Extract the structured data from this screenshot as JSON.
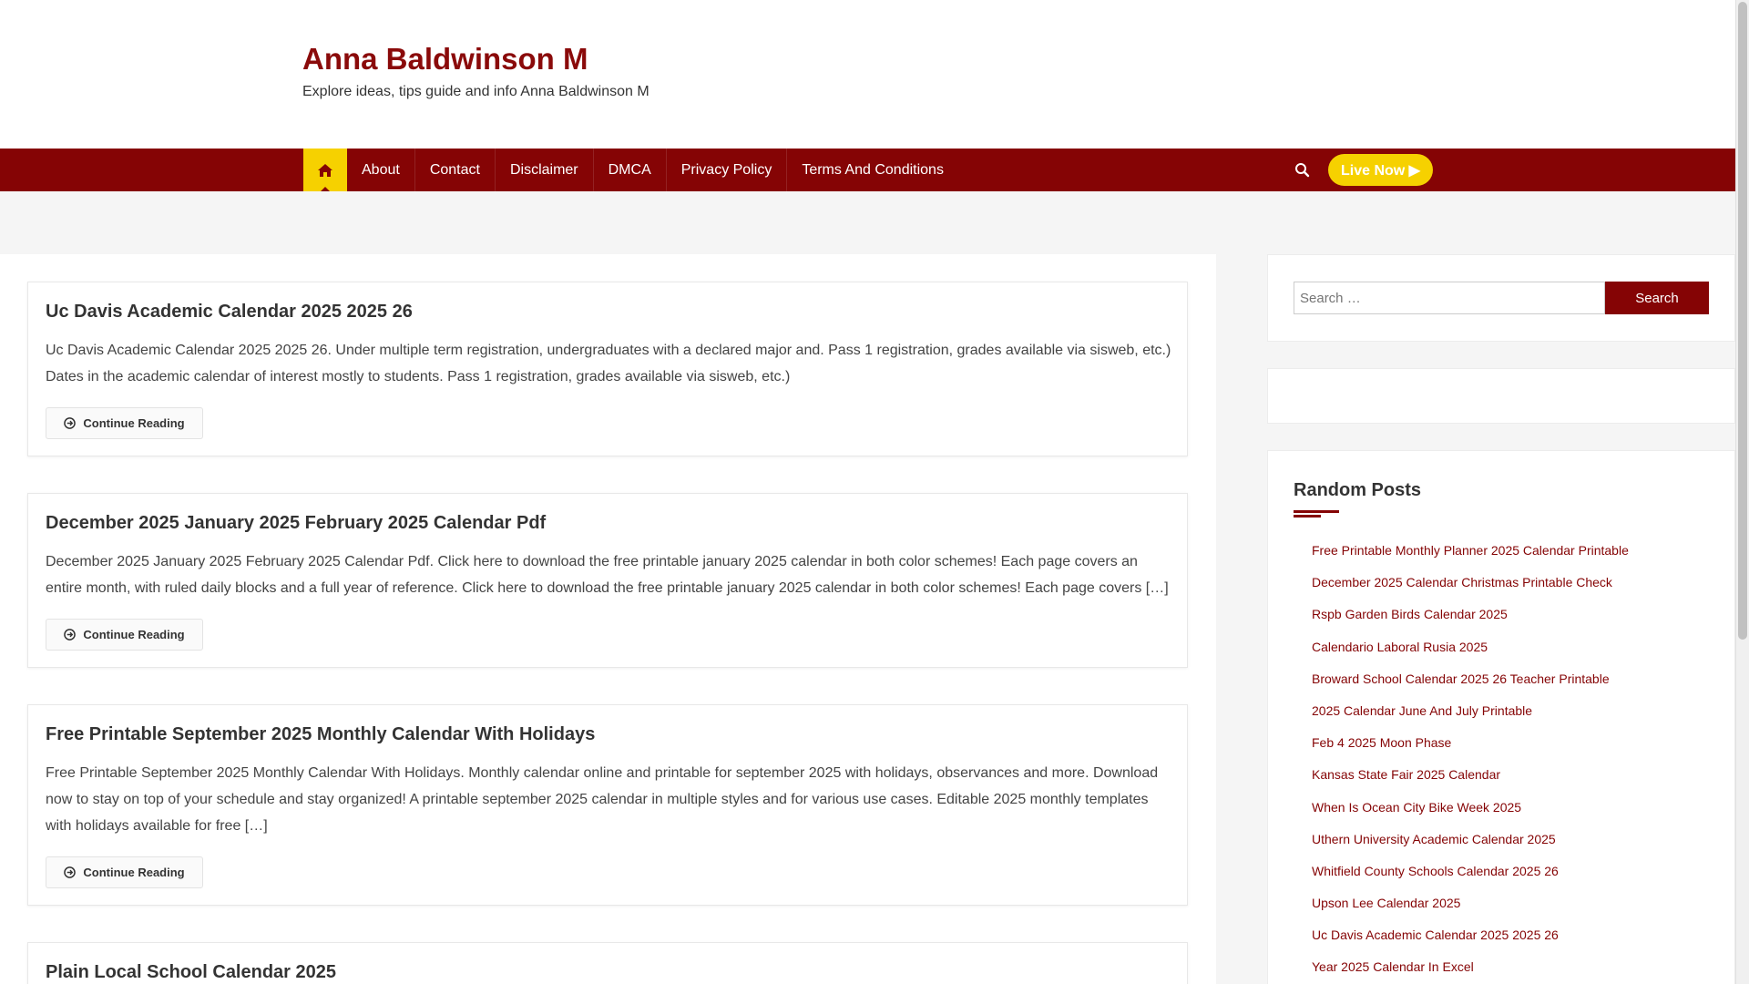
{
  "site": {
    "title": "Anna Baldwinson M",
    "description": "Explore ideas, tips guide and info Anna Baldwinson M"
  },
  "nav": {
    "items": [
      "About",
      "Contact",
      "Disclaimer",
      "DMCA",
      "Privacy Policy",
      "Terms And Conditions"
    ],
    "live_label": "Live Now ▶"
  },
  "posts": [
    {
      "title": "Uc Davis Academic Calendar 2025 2025 26",
      "excerpt": "Uc Davis Academic Calendar 2025 2025 26. Under multiple term registration, undergraduates with a declared major and. Pass 1 registration, grades available via sisweb, etc.) Dates in the academic calendar of interest mostly to students. Pass 1 registration, grades available via sisweb, etc.)",
      "button": "Continue Reading"
    },
    {
      "title": "December 2025 January 2025 February 2025 Calendar Pdf",
      "excerpt": "December 2025 January 2025 February 2025 Calendar Pdf. Click here to download the free printable january 2025 calendar in both color schemes! Each page covers an entire month, with ruled daily blocks and a full year of reference. Click here to download the free printable january 2025 calendar in both color schemes! Each page covers […]",
      "button": "Continue Reading"
    },
    {
      "title": "Free Printable September 2025 Monthly Calendar With Holidays",
      "excerpt": "Free Printable September 2025 Monthly Calendar With Holidays. Monthly calendar online and printable for september 2025 with holidays, observances and more. Download now to stay on top of your schedule and stay organized! A printable september 2025 calendar in multiple styles and for various use cases. Editable 2025 monthly templates with holidays available for free […]",
      "button": "Continue Reading"
    },
    {
      "title": "Plain Local School Calendar 2025"
    }
  ],
  "sidebar": {
    "search": {
      "placeholder": "Search …",
      "button": "Search"
    },
    "random_posts": {
      "title": "Random Posts",
      "items": [
        "Free Printable Monthly Planner 2025 Calendar Printable",
        "December 2025 Calendar Christmas Printable Check",
        "Rspb Garden Birds Calendar 2025",
        "Calendario Laboral Rusia 2025",
        "Broward School Calendar 2025 26 Teacher Printable",
        "2025 Calendar June And July Printable",
        "Feb 4 2025 Moon Phase",
        "Kansas State Fair 2025 Calendar",
        "When Is Ocean City Bike Week 2025",
        "Uthern University Academic Calendar 2025",
        "Whitfield County Schools Calendar 2025 26",
        "Upson Lee Calendar 2025",
        "Uc Davis Academic Calendar 2025 2025 26",
        "Year 2025 Calendar In Excel"
      ]
    }
  },
  "colors": {
    "brand": "#850405",
    "accent": "#f6d100"
  }
}
